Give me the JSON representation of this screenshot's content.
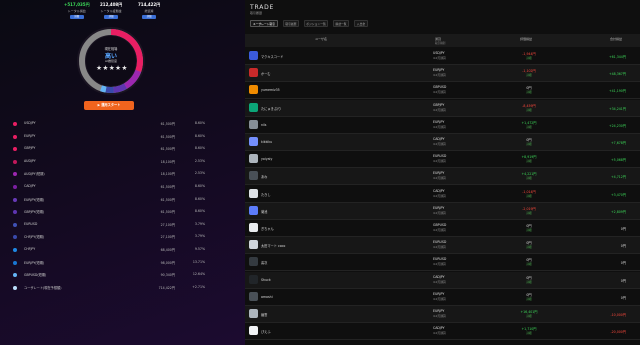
{
  "colors": {
    "accent": "#f0641e",
    "positive": "#3ddc5a",
    "negative": "#ff4a3d",
    "link": "#58a6ff"
  },
  "left": {
    "stats": [
      {
        "value": "+517,035円",
        "label": "トータル損益",
        "badge": "詳細",
        "color": "#3ddc5a"
      },
      {
        "value": "212,408円",
        "label": "トータル証拠金",
        "badge": "詳細",
        "color": "#ffffff"
      },
      {
        "value": "714,422円",
        "label": "総資産",
        "badge": "詳細",
        "color": "#ffffff"
      }
    ],
    "center": {
      "line1": "現在相場",
      "line2": "高い",
      "line3": "AI推奨度",
      "stars": "★★★★★"
    },
    "button_label": "▶ 運用スタート",
    "rows": [
      {
        "name": "USDJPY",
        "amount": "61,500円",
        "pct": "8.60%",
        "color": "#e91e63"
      },
      {
        "name": "EURJPY",
        "amount": "61,500円",
        "pct": "8.60%",
        "color": "#e91e63"
      },
      {
        "name": "GBPJPY",
        "amount": "61,500円",
        "pct": "8.60%",
        "color": "#e91e63"
      },
      {
        "name": "AUDJPY",
        "amount": "18,100円",
        "pct": "2.53%",
        "color": "#c2185b"
      },
      {
        "name": "AUDJPY(短期)",
        "amount": "18,100円",
        "pct": "2.53%",
        "color": "#9c27b0"
      },
      {
        "name": "CADJPY",
        "amount": "61,500円",
        "pct": "8.60%",
        "color": "#7b1fa2"
      },
      {
        "name": "EURJPY(短期)",
        "amount": "61,500円",
        "pct": "8.60%",
        "color": "#673ab7"
      },
      {
        "name": "GBPJPY(短期)",
        "amount": "61,500円",
        "pct": "8.60%",
        "color": "#5e35b1"
      },
      {
        "name": "EURUSD",
        "amount": "27,100円",
        "pct": "3.79%",
        "color": "#3f51b5"
      },
      {
        "name": "CHFJPY(短期)",
        "amount": "27,100円",
        "pct": "3.79%",
        "color": "#3949ab"
      },
      {
        "name": "CHFJPY",
        "amount": "68,400円",
        "pct": "9.57%",
        "color": "#1e88e5"
      },
      {
        "name": "EURJPY(短期)",
        "amount": "98,000円",
        "pct": "13.71%",
        "color": "#1976d2"
      },
      {
        "name": "GBPUSD(短期)",
        "amount": "90,340円",
        "pct": "12.64%",
        "color": "#64b5f6"
      },
      {
        "name": "ユーザレート(現在予想額)",
        "amount": "714,422円",
        "pct": "+2.71%",
        "color": "#bbdefb"
      }
    ]
  },
  "right": {
    "title": "TRADE",
    "subtitle": "取引履歴",
    "tabs": [
      "ユーザレート取引",
      "取引履歴",
      "ポジション一覧",
      "損益一覧",
      "入出金"
    ],
    "header": {
      "user": "ユーザ名",
      "pair": "通貨",
      "pair_sub": "取引種別",
      "pl": "評価損益",
      "total": "合計損益"
    },
    "rows": [
      {
        "name": "マクキスコード",
        "pair": "USDJPY",
        "type": "4.0万通貨",
        "pl": "-1,944円",
        "pl_sub": "詳細",
        "total": "+61,344円",
        "pl_sign": "neg",
        "total_sign": "pos",
        "avatar": "#3b5bdb"
      },
      {
        "name": "かーむ",
        "pair": "EURJPY",
        "type": "4.0万通貨",
        "pl": "-1,102円",
        "pl_sub": "詳細",
        "total": "+48,367円",
        "pl_sign": "neg",
        "total_sign": "pos",
        "avatar": "#c92a2a"
      },
      {
        "name": "yumemiz35",
        "pair": "GBPUSD",
        "type": "4.0万通貨",
        "pl": "0円",
        "pl_sub": "詳細",
        "total": "+41,190円",
        "pl_sign": "neu",
        "total_sign": "pos",
        "avatar": "#f08c00"
      },
      {
        "name": "たにゅきぷ/り",
        "pair": "GBPJPY",
        "type": "4.0万通貨",
        "pl": "-8,459円",
        "pl_sub": "詳細",
        "total": "+34,241円",
        "pl_sign": "neg",
        "total_sign": "pos",
        "avatar": "#0ca678"
      },
      {
        "name": "nils",
        "pair": "EURJPY",
        "type": "4.0万通貨",
        "pl": "+1,472円",
        "pl_sub": "詳細",
        "total": "+24,230円",
        "pl_sign": "pos",
        "total_sign": "pos",
        "avatar": "#868e96"
      },
      {
        "name": "kikkiku",
        "pair": "CADJPY",
        "type": "4.0万通貨",
        "pl": "0円",
        "pl_sub": "詳細",
        "total": "+7,678円",
        "pl_sign": "neu",
        "total_sign": "pos",
        "avatar": "#748ffc"
      },
      {
        "name": "yoiyaiy",
        "pair": "EURUSD",
        "type": "4.0万通貨",
        "pl": "+8,919円",
        "pl_sub": "詳細",
        "total": "+5,068円",
        "pl_sign": "pos",
        "total_sign": "pos",
        "avatar": "#adb5bd"
      },
      {
        "name": "あわ",
        "pair": "EURJPY",
        "type": "4.0万通貨",
        "pl": "+4,221円",
        "pl_sub": "詳細",
        "total": "+4,712円",
        "pl_sign": "pos",
        "total_sign": "pos",
        "avatar": "#495057"
      },
      {
        "name": "たきし",
        "pair": "CADJPY",
        "type": "4.0万通貨",
        "pl": "-1,014円",
        "pl_sub": "詳細",
        "total": "+3,470円",
        "pl_sign": "neg",
        "total_sign": "pos",
        "avatar": "#dee2e6"
      },
      {
        "name": "菊池",
        "pair": "EURJPY",
        "type": "4.0万通貨",
        "pl": "-2,019円",
        "pl_sub": "詳細",
        "total": "+2,809円",
        "pl_sign": "neg",
        "total_sign": "pos",
        "avatar": "#5c7cfa"
      },
      {
        "name": "ぎちゃん",
        "pair": "GBPUSD",
        "type": "4.0万通貨",
        "pl": "0円",
        "pl_sub": "詳細",
        "total": "0円",
        "pl_sign": "neu",
        "total_sign": "neu",
        "avatar": "#e9ecef"
      },
      {
        "name": "太田マート coco",
        "pair": "EURUSD",
        "type": "4.0万通貨",
        "pl": "0円",
        "pl_sub": "詳細",
        "total": "0円",
        "pl_sign": "neu",
        "total_sign": "neu",
        "avatar": "#ced4da"
      },
      {
        "name": "善次",
        "pair": "EURUSD",
        "type": "4.0万通貨",
        "pl": "0円",
        "pl_sub": "詳細",
        "total": "0円",
        "pl_sign": "neu",
        "total_sign": "neu",
        "avatar": "#343a40"
      },
      {
        "name": "Shuck",
        "pair": "CADJPY",
        "type": "4.0万通貨",
        "pl": "0円",
        "pl_sub": "詳細",
        "total": "0円",
        "pl_sign": "neu",
        "total_sign": "neu",
        "avatar": "#212529"
      },
      {
        "name": "amoshi",
        "pair": "EURJPY",
        "type": "4.0万通貨",
        "pl": "0円",
        "pl_sub": "詳細",
        "total": "0円",
        "pl_sign": "neu",
        "total_sign": "neu",
        "avatar": "#495057"
      },
      {
        "name": "幽霊",
        "pair": "EURJPY",
        "type": "4.0万通貨",
        "pl": "+16,401円",
        "pl_sub": "詳細",
        "total": "-10,000円",
        "pl_sign": "pos",
        "total_sign": "neg",
        "avatar": "#adb5bd"
      },
      {
        "name": "ぴえふ",
        "pair": "CADJPY",
        "type": "4.0万通貨",
        "pl": "+1,710円",
        "pl_sub": "詳細",
        "total": "-20,000円",
        "pl_sign": "pos",
        "total_sign": "neg",
        "avatar": "#f1f3f5"
      }
    ]
  }
}
